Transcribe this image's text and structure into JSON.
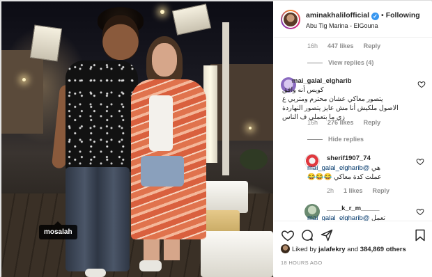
{
  "post": {
    "author": "aminakhalilofficial",
    "verified_mark": "✓",
    "separator": "•",
    "follow_label": "Following",
    "location": "Abu Tig Marina - ElGouna",
    "photo_tag": "mosalah"
  },
  "comments": {
    "top_meta": {
      "time": "16h",
      "likes": "447 likes",
      "reply": "Reply"
    },
    "view_replies": "View replies (4)",
    "items": [
      {
        "user": "mai_galal_elgharib",
        "lines": [
          "كويس أنه وافق",
          "يتصور معاكي عشان محترم ومتربي ع",
          "الاصول ملكيش أنا مش عايز يتصور النهاردة",
          "زي ما بتعملي ف الناس"
        ],
        "time": "16h",
        "likes": "276 likes",
        "reply": "Reply"
      }
    ],
    "hide_replies": "Hide replies",
    "replies": [
      {
        "user": "sherif1907_74",
        "mention": "@mai_galal_elgharib",
        "prefix": "هي",
        "line2": "عملت كدة معاكي 😂😂😂",
        "time": "2h",
        "likes": "1 likes",
        "reply": "Reply"
      },
      {
        "user": "____k_r_m_____",
        "mention": "@mai_galal_elgharib",
        "prefix": "تعمل"
      }
    ]
  },
  "actions": {
    "liked_by_prefix": "Liked by",
    "liked_by_user": "jalafekry",
    "liked_by_and": "and",
    "liked_by_count": "384,869 others",
    "timestamp": "18 HOURS AGO"
  },
  "icons": {
    "heart": "heart-icon",
    "comment": "comment-icon",
    "share": "share-icon",
    "save": "bookmark-icon"
  },
  "colors": {
    "verified": "#3897f0",
    "text": "#262626",
    "muted": "#8e8e8e",
    "mention": "#00376b"
  }
}
